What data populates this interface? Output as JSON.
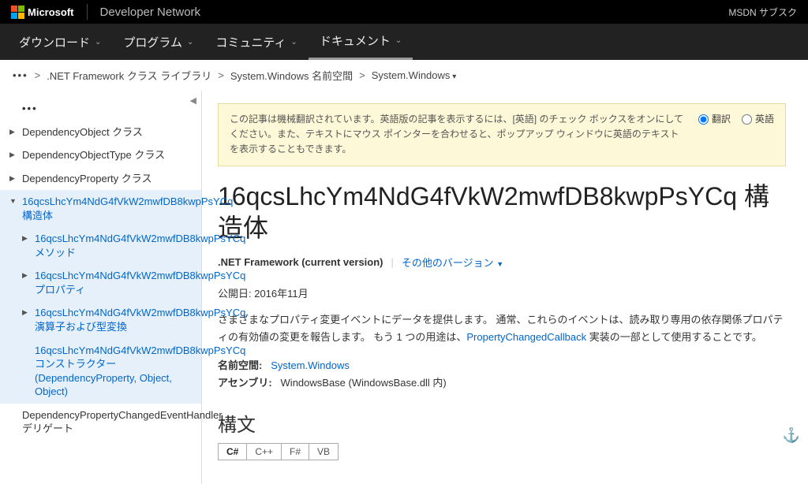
{
  "header": {
    "ms": "Microsoft",
    "dev_network": "Developer Network",
    "right": "MSDN サブスク"
  },
  "nav": {
    "items": [
      {
        "label": "ダウンロード"
      },
      {
        "label": "プログラム"
      },
      {
        "label": "コミュニティ"
      },
      {
        "label": "ドキュメント"
      }
    ]
  },
  "breadcrumb": {
    "items": [
      {
        "label": ".NET Framework クラス ライブラリ"
      },
      {
        "label": "System.Windows 名前空間"
      },
      {
        "label": "System.Windows"
      }
    ]
  },
  "sidebar": {
    "ellipsis": "•••",
    "items": [
      {
        "label": "DependencyObject クラス"
      },
      {
        "label": "DependencyObjectType クラス"
      },
      {
        "label": "DependencyProperty クラス"
      },
      {
        "label": "16qcsLhcYm4NdG4fVkW2mwfDB8kwpPsYCq 構造体",
        "selected": true,
        "children": [
          {
            "label": "16qcsLhcYm4NdG4fVkW2mwfDB8kwpPsYCq メソッド"
          },
          {
            "label": "16qcsLhcYm4NdG4fVkW2mwfDB8kwpPsYCq プロパティ"
          },
          {
            "label": "16qcsLhcYm4NdG4fVkW2mwfDB8kwpPsYCq 演算子および型変換"
          },
          {
            "label": "16qcsLhcYm4NdG4fVkW2mwfDB8kwpPsYCq コンストラクター (DependencyProperty, Object, Object)",
            "nocaret": true
          }
        ]
      },
      {
        "label": "DependencyPropertyChangedEventHandler デリゲート",
        "nocaret": true
      }
    ]
  },
  "notice": {
    "text": "この記事は機械翻訳されています。英語版の記事を表示するには、[英語] のチェック ボックスをオンにしてください。また、テキストにマウス ポインターを合わせると、ポップアップ ウィンドウに英語のテキストを表示することもできます。",
    "opt_translate": "翻訳",
    "opt_english": "英語"
  },
  "page": {
    "title": "16qcsLhcYm4NdG4fVkW2mwfDB8kwpPsYCq 構造体",
    "version_current": ".NET Framework (current version)",
    "version_other": "その他のバージョン",
    "pubdate": "公開日: 2016年11月",
    "desc_pre": "さまざまなプロパティ変更イベントにデータを提供します。 通常、これらのイベントは、読み取り専用の依存関係プロパティの有効値の変更を報告します。 もう 1 つの用途は、",
    "desc_link": "PropertyChangedCallback",
    "desc_post": " 実装の一部として使用することです。",
    "ns_label": "名前空間:",
    "ns_value": "System.Windows",
    "asm_label": "アセンブリ:",
    "asm_value": "WindowsBase (WindowsBase.dll 内)",
    "syntax_heading": "構文"
  },
  "lang_tabs": [
    "C#",
    "C++",
    "F#",
    "VB"
  ]
}
